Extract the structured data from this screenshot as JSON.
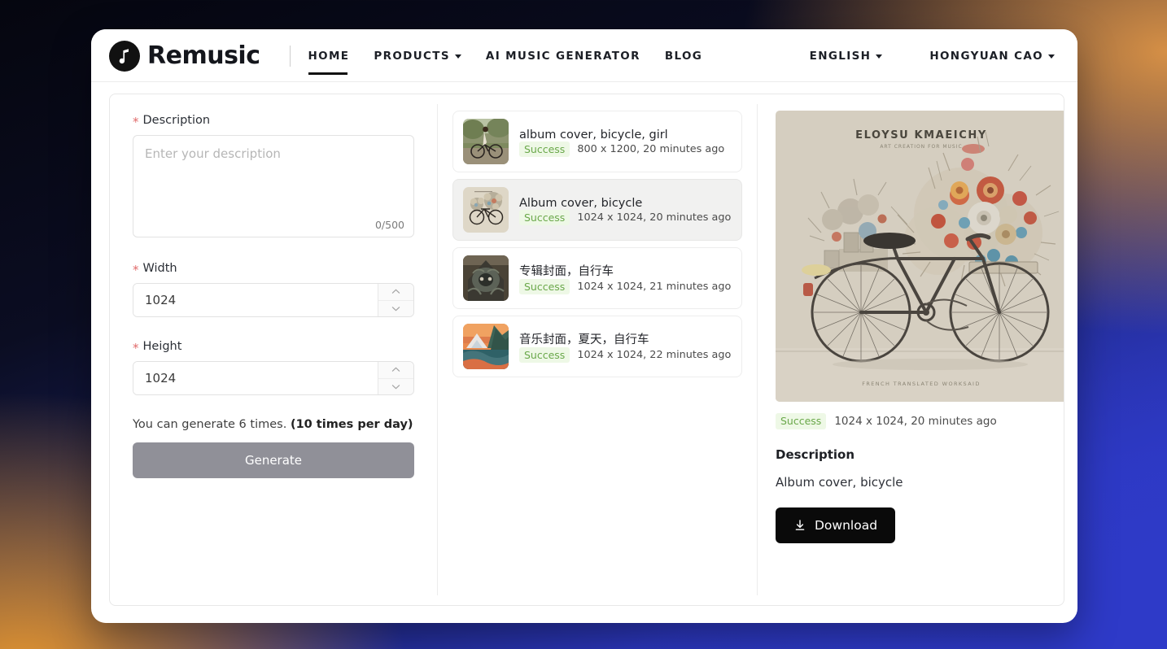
{
  "header": {
    "brand": "Remusic",
    "logo_icon": "music-note-circle-icon",
    "links": [
      {
        "label": "HOME",
        "active": true,
        "caret": false
      },
      {
        "label": "PRODUCTS",
        "active": false,
        "caret": true
      },
      {
        "label": "AI MUSIC GENERATOR",
        "active": false,
        "caret": false
      },
      {
        "label": "BLOG",
        "active": false,
        "caret": false
      }
    ],
    "language": "ENGLISH",
    "user": "HONGYUAN CAO"
  },
  "form": {
    "description_label": "Description",
    "description_value": "",
    "description_placeholder": "Enter your description",
    "char_count": "0/500",
    "width_label": "Width",
    "width_value": "1024",
    "height_label": "Height",
    "height_value": "1024",
    "quota_prefix": "You can generate 6 times. ",
    "quota_bold": "(10 times per day)",
    "generate_label": "Generate",
    "required_mark": "*"
  },
  "history": {
    "items": [
      {
        "title": "album cover, bicycle, girl",
        "status": "Success",
        "meta": "800 x 1200, 20 minutes ago",
        "selected": false,
        "thumb": "girl-riding-bicycle-photo"
      },
      {
        "title": "Album cover, bicycle",
        "status": "Success",
        "meta": "1024 x 1024, 20 minutes ago",
        "selected": true,
        "thumb": "bicycle-with-flowers-illustration"
      },
      {
        "title": "专辑封面，自行车",
        "status": "Success",
        "meta": "1024 x 1024, 21 minutes ago",
        "selected": false,
        "thumb": "dark-ornate-symmetric-artwork"
      },
      {
        "title": "音乐封面，夏天，自行车",
        "status": "Success",
        "meta": "1024 x 1024, 22 minutes ago",
        "selected": false,
        "thumb": "mountain-sunset-landscape"
      }
    ]
  },
  "preview": {
    "image_alt": "album cover illustration of a bicycle carrying a large bouquet of flowers on a beige background",
    "image_title_text": "ELOYSU KMAEICHY",
    "image_footer_text": "FRENCH TRANSLATED WORKSAID",
    "status": "Success",
    "meta": "1024 x 1024, 20 minutes ago",
    "description_heading": "Description",
    "description_text": "Album cover, bicycle",
    "download_label": "Download",
    "download_icon": "download-icon"
  },
  "colors": {
    "accent_success_text": "#6aa84a",
    "accent_success_bg": "#eef8e6",
    "required_star": "#e06a6a",
    "generate_button": "#909098",
    "download_button": "#0a0a0a"
  }
}
